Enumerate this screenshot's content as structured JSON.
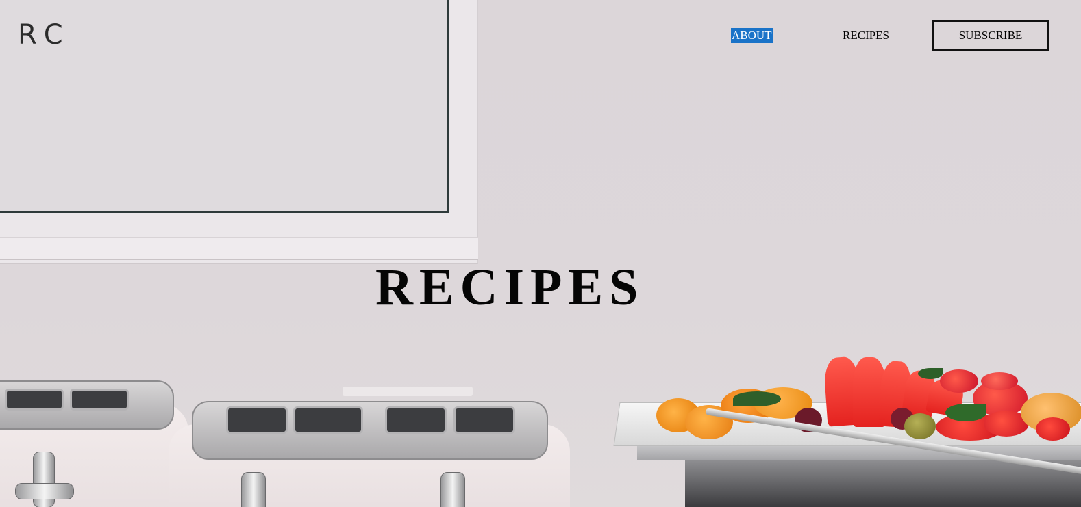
{
  "header": {
    "logo": "RC",
    "nav": [
      {
        "label": "ABOUT",
        "selected": true
      },
      {
        "label": "RECIPES",
        "selected": false
      }
    ],
    "subscribe_label": "SUBSCRIBE"
  },
  "hero": {
    "title": "RECIPES"
  },
  "colors": {
    "selection_highlight": "#1a73c8",
    "text": "#000000",
    "background": "#dcd6d8"
  }
}
